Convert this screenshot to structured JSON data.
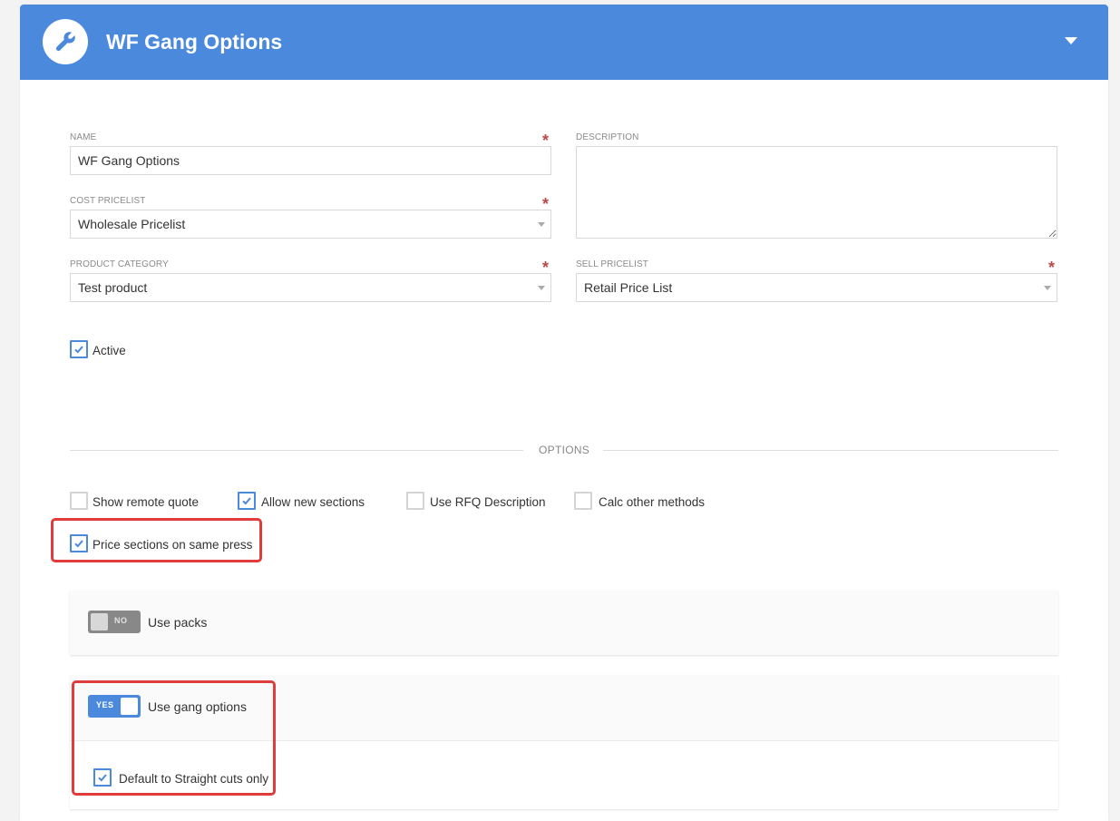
{
  "header": {
    "title": "WF Gang Options",
    "icon": "wrench-icon",
    "collapse_icon": "chevron-down-icon"
  },
  "form": {
    "name": {
      "label": "NAME",
      "value": "WF Gang Options",
      "required_mark": "*"
    },
    "description": {
      "label": "DESCRIPTION",
      "value": ""
    },
    "cost_pricelist": {
      "label": "COST PRICELIST",
      "value": "Wholesale Pricelist",
      "required_mark": "*"
    },
    "product_category": {
      "label": "PRODUCT CATEGORY",
      "value": "Test product",
      "required_mark": "*"
    },
    "sell_pricelist": {
      "label": "SELL PRICELIST",
      "value": "Retail Price List",
      "required_mark": "*"
    },
    "active": {
      "label": "Active",
      "checked": true
    }
  },
  "options": {
    "heading": "OPTIONS",
    "checkboxes": [
      {
        "label": "Show remote quote",
        "checked": false
      },
      {
        "label": "Allow new sections",
        "checked": true
      },
      {
        "label": "Use RFQ Description",
        "checked": false
      },
      {
        "label": "Calc other methods",
        "checked": false
      },
      {
        "label": "Price sections on same press",
        "checked": true
      }
    ]
  },
  "packs": {
    "toggle_text": "NO",
    "label": "Use packs",
    "enabled": false
  },
  "gang": {
    "toggle_text": "YES",
    "label": "Use gang options",
    "enabled": true,
    "straight_cuts": {
      "label": "Default to Straight cuts only",
      "checked": true
    }
  },
  "colors": {
    "accent": "#4a89dc",
    "highlight": "#e03c3c",
    "required": "#b94a48"
  }
}
